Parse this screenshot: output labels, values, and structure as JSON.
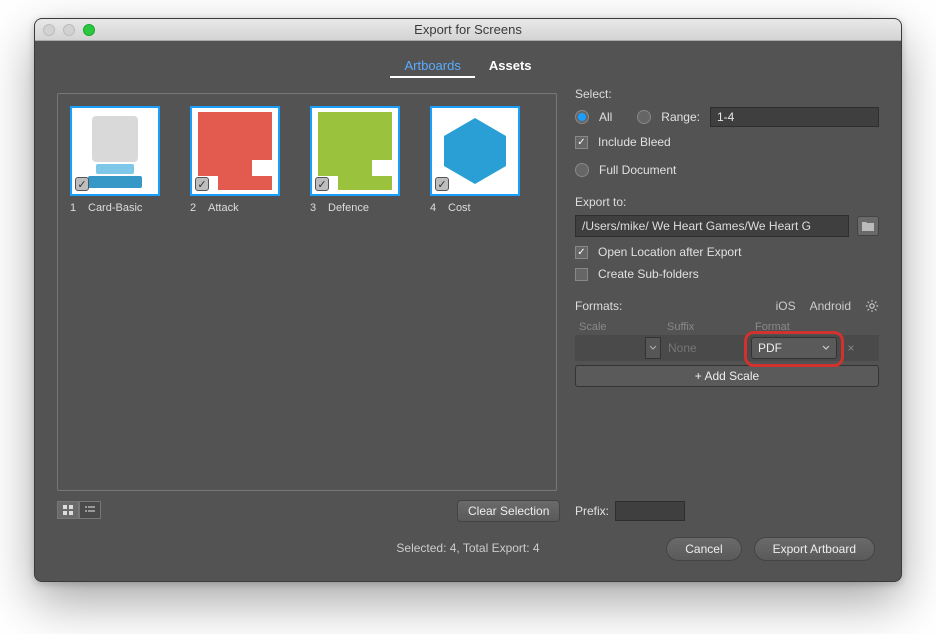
{
  "window": {
    "title": "Export for Screens"
  },
  "tabs": {
    "artboards": "Artboards",
    "assets": "Assets"
  },
  "artboards": [
    {
      "index": "1",
      "name": "Card-Basic"
    },
    {
      "index": "2",
      "name": "Attack"
    },
    {
      "index": "3",
      "name": "Defence"
    },
    {
      "index": "4",
      "name": "Cost"
    }
  ],
  "buttons": {
    "clear_selection": "Clear Selection",
    "cancel": "Cancel",
    "export": "Export Artboard"
  },
  "select": {
    "label": "Select:",
    "all": "All",
    "range": "Range:",
    "range_value": "1-4",
    "include_bleed": "Include Bleed",
    "full_document": "Full Document"
  },
  "export_to": {
    "label": "Export to:",
    "path": "/Users/mike/ We Heart Games/We Heart G",
    "open_after": "Open Location after Export",
    "create_subfolders": "Create Sub-folders"
  },
  "formats": {
    "label": "Formats:",
    "ios": "iOS",
    "android": "Android",
    "col_scale": "Scale",
    "col_suffix": "Suffix",
    "col_format": "Format",
    "suffix_placeholder": "None",
    "format_value": "PDF",
    "add_scale": "+  Add Scale"
  },
  "prefix": {
    "label": "Prefix:",
    "value": ""
  },
  "status": "Selected: 4, Total Export: 4"
}
